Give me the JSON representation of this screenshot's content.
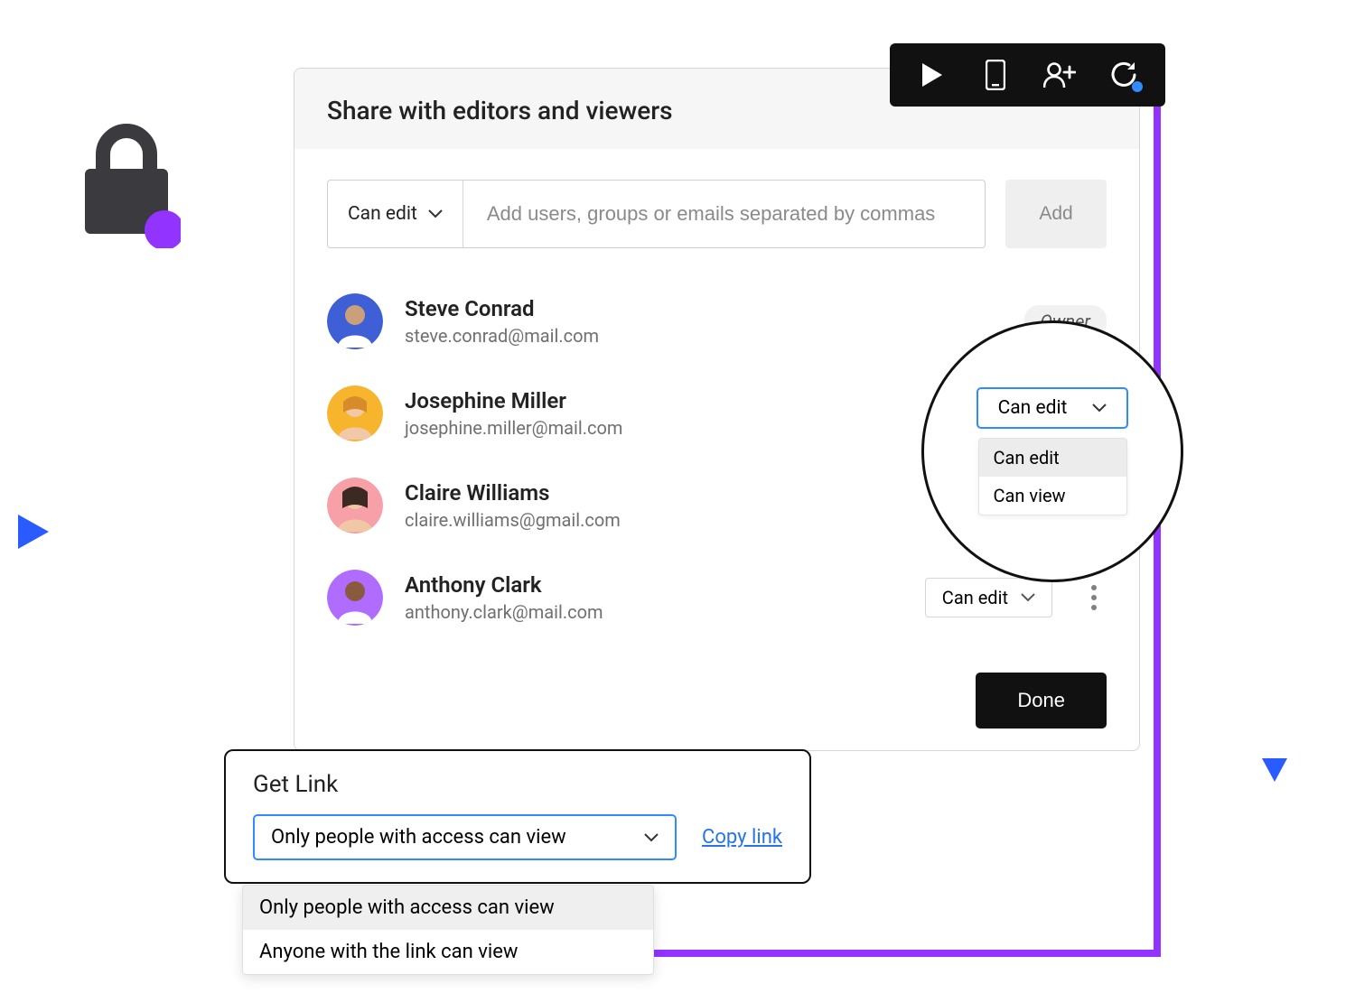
{
  "decoration": {
    "lock_color": "#3b3b3f",
    "accent_dot": "#9233ff",
    "triangle_color": "#2a5bff"
  },
  "toolbar": {
    "icons": [
      "play-icon",
      "device-icon",
      "add-user-icon",
      "refresh-icon"
    ],
    "refresh_dot": "#2f8bff"
  },
  "dialog": {
    "title": "Share with editors and viewers",
    "perm_default": "Can edit",
    "input_placeholder": "Add users, groups or emails separated by commas",
    "add_label": "Add",
    "done_label": "Done",
    "owner_label": "Owner"
  },
  "users": [
    {
      "name": "Steve Conrad",
      "email": "steve.conrad@mail.com",
      "avatar_bg": "#3e5fd6",
      "role": "owner"
    },
    {
      "name": "Josephine Miller",
      "email": "josephine.miller@mail.com",
      "avatar_bg": "#f7b52e",
      "role": "editor"
    },
    {
      "name": "Claire Williams",
      "email": "claire.williams@gmail.com",
      "avatar_bg": "#f7a0a7",
      "role": "locked"
    },
    {
      "name": "Anthony Clark",
      "email": "anthony.clark@mail.com",
      "avatar_bg": "#b06cff",
      "role": "editor",
      "perm_label": "Can edit"
    }
  ],
  "magnifier": {
    "selected": "Can edit",
    "options": [
      "Can edit",
      "Can view"
    ]
  },
  "getlink": {
    "title": "Get Link",
    "selected": "Only people with access can view",
    "copy_label": "Copy link",
    "options": [
      "Only people with access can view",
      "Anyone with the link can view"
    ]
  }
}
